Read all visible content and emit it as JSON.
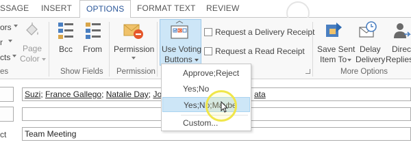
{
  "tabs": [
    {
      "label": "SSAGE",
      "active": false
    },
    {
      "label": "INSERT",
      "active": false
    },
    {
      "label": "OPTIONS",
      "active": true
    },
    {
      "label": "FORMAT TEXT",
      "active": false
    },
    {
      "label": "REVIEW",
      "active": false
    }
  ],
  "ribbon": {
    "left_partial": {
      "line1": "ors",
      "line2": "r",
      "line3": "cts",
      "group_tail": "es"
    },
    "page_color": {
      "line1": "Page",
      "line2": "Color",
      "icon": "paint-bucket-icon"
    },
    "bcc": {
      "label": "Bcc",
      "icon": "bcc-icon"
    },
    "from": {
      "label": "From",
      "icon": "from-icon"
    },
    "show_fields_group": "Show Fields",
    "permission": {
      "label": "Permission",
      "icon": "permission-icon"
    },
    "permission_group": "Permission",
    "voting": {
      "line1": "Use Voting",
      "line2": "Buttons",
      "icon": "voting-ballot-icon"
    },
    "delivery_receipt": {
      "label": "Request a Delivery Receipt",
      "checked": false
    },
    "read_receipt": {
      "label": "Request a Read Receipt",
      "checked": false
    },
    "save_sent": {
      "line1": "Save Sent",
      "line2": "Item To",
      "icon": "save-sent-folder-icon"
    },
    "delay_delivery": {
      "line1": "Delay",
      "line2": "Delivery",
      "icon": "clock-envelope-icon"
    },
    "direct_replies": {
      "line1": "Direc",
      "line2": "Replies",
      "icon": "direct-replies-icon"
    },
    "more_options_group": "More Options"
  },
  "form": {
    "recipients": [
      "Suzi",
      "France Gallego",
      "Natalie Day",
      "Jonny R"
    ],
    "recipients_tail": "ata",
    "cc_value": "",
    "subject_label": "ct",
    "subject_value": "Team Meeting"
  },
  "dropdown": {
    "items": [
      {
        "label": "Approve;Reject",
        "highlighted": false
      },
      {
        "label": "Yes;No",
        "highlighted": false
      },
      {
        "label": "Yes;No;Maybe",
        "highlighted": true
      },
      {
        "label": "Custom...",
        "highlighted": false
      }
    ]
  },
  "colors": {
    "accent": "#2b579a",
    "highlight": "#cde6f7",
    "cursor_ring": "#f0e64a"
  }
}
